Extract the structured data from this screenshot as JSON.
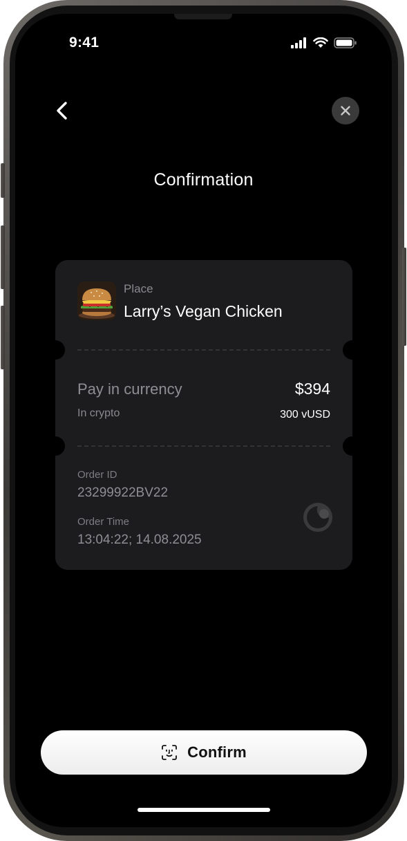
{
  "status_bar": {
    "time": "9:41",
    "icons": [
      "cellular-signal-icon",
      "wifi-icon",
      "battery-icon"
    ]
  },
  "header": {
    "back_icon": "chevron-left-icon",
    "close_icon": "close-icon",
    "title": "Confirmation"
  },
  "card": {
    "place_label": "Place",
    "place_name": "Larry’s Vegan Chicken",
    "place_image": "burger-thumbnail",
    "pay_label": "Pay in currency",
    "pay_value": "$394",
    "crypto_label": "In crypto",
    "crypto_value": "300 vUSD",
    "order_id_label": "Order ID",
    "order_id_value": "23299922BV22",
    "order_time_label": "Order Time",
    "order_time_value": "13:04:22; 14.08.2025",
    "brand_icon": "brand-logo-icon"
  },
  "footer": {
    "confirm_icon": "face-id-icon",
    "confirm_label": "Confirm"
  },
  "colors": {
    "background": "#000000",
    "card": "#1c1c1e",
    "button": "#ffffff",
    "muted_text": "#8e8e93"
  }
}
